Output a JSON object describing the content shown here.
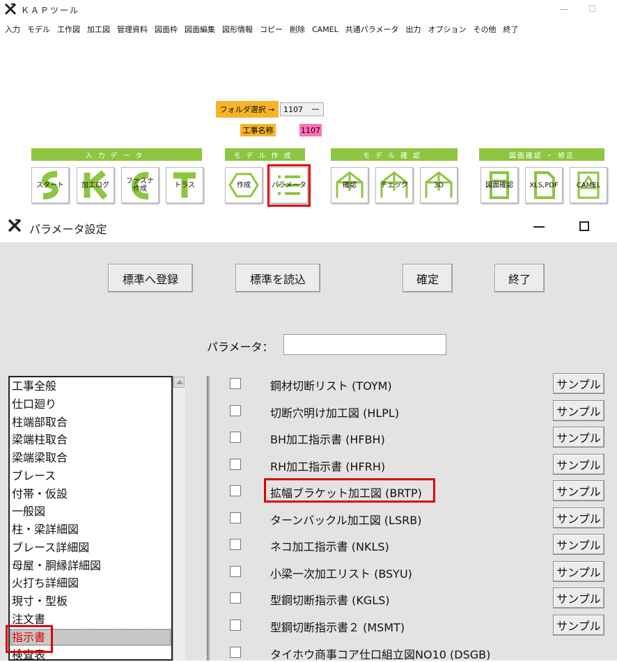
{
  "app": {
    "title": "ＫＡＰツール",
    "menu": [
      "入力",
      "モデル",
      "工作図",
      "加工図",
      "管理資料",
      "図面枠",
      "図面編集",
      "図形情報",
      "コピー",
      "削除",
      "CAMEL",
      "共通パラメータ",
      "出力",
      "オプション",
      "その他",
      "終了"
    ],
    "folder_button": "フォルダ選択 →",
    "folder_value": "1107",
    "koji_label": "工事名称",
    "koji_value": "1107",
    "groups": [
      "入力データ",
      "モデル作成",
      "モデル確認",
      "図面確認 ・ 修正"
    ],
    "tools": [
      "スタート",
      "加工ログ",
      "ファスナ作成",
      "トラス",
      "作成",
      "パラメータ",
      "確認",
      "チェック",
      "3D",
      "図面確認",
      "XLS,PDF",
      "CAMEL"
    ],
    "colors": {
      "accent_green": "#8dc63f",
      "accent_orange": "#f5b428",
      "accent_pink": "#ff6fb7",
      "highlight_red": "#e00000"
    }
  },
  "dialog": {
    "title": "パラメータ設定",
    "buttons": [
      "標準へ登録",
      "標準を読込",
      "確定",
      "終了"
    ],
    "param_label": "パラメータ：",
    "param_value": "",
    "categories": [
      "工事全般",
      "仕口廻り",
      "柱端部取合",
      "梁端柱取合",
      "梁端梁取合",
      "ブレース",
      "付帯・仮設",
      "一般図",
      "柱・梁詳細図",
      "ブレース詳細図",
      "母屋・胴縁詳細図",
      "火打ち詳細図",
      "現寸・型板",
      "注文書",
      "指示書",
      "検査表"
    ],
    "selected_category": "指示書",
    "sample_label": "サンプル",
    "rows": [
      {
        "label": "鋼材切断リスト (TOYM)",
        "has_sample": true
      },
      {
        "label": "切断穴明け加工図 (HLPL)",
        "has_sample": true
      },
      {
        "label": "BH加工指示書 (HFBH)",
        "has_sample": true
      },
      {
        "label": "RH加工指示書 (HFRH)",
        "has_sample": true
      },
      {
        "label": "拡幅ブラケット加工図 (BRTP)",
        "has_sample": true
      },
      {
        "label": "ターンバックル加工図 (LSRB)",
        "has_sample": true
      },
      {
        "label": "ネコ加工指示書 (NKLS)",
        "has_sample": true
      },
      {
        "label": "小梁一次加工リスト (BSYU)",
        "has_sample": true
      },
      {
        "label": "型鋼切断指示書 (KGLS)",
        "has_sample": true
      },
      {
        "label": "型鋼切断指示書２ (MSMT)",
        "has_sample": true
      },
      {
        "label": "タイホウ商事コア仕口組立図NO10 (DSGB)",
        "has_sample": false
      }
    ]
  }
}
